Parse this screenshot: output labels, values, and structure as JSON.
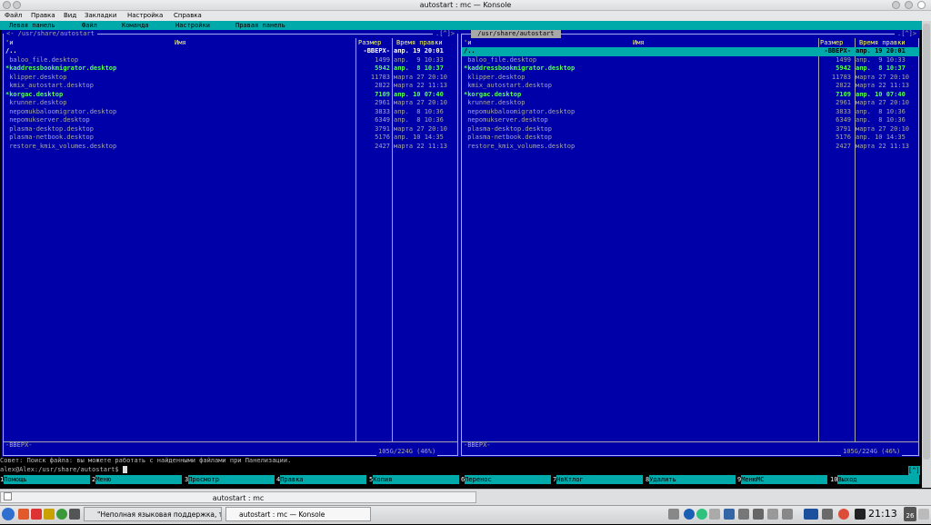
{
  "window": {
    "title": "autostart : mc — Konsole"
  },
  "menu": [
    "Файл",
    "Правка",
    "Вид",
    "Закладки",
    "Настройка",
    "Справка"
  ],
  "mc_menu": [
    "Левая панель",
    "Файл",
    "Команда",
    "Настройки",
    "Правая панель"
  ],
  "left_panel": {
    "path": "<- /usr/share/autostart",
    "corner": ".[^]>",
    "status": "-ВВЕРХ-",
    "disk": "105G/224G (46%)"
  },
  "right_panel": {
    "path": " /usr/share/autostart ",
    "corner": ".[^]>",
    "status": "-ВВЕРХ-",
    "disk": "105G/224G (46%)"
  },
  "columns": {
    "marker": "'и",
    "name": "Имя",
    "size": "Размер",
    "time": "Время правки"
  },
  "files": [
    {
      "name": "/..",
      "size": "-ВВЕРХ-",
      "time": "апр. 19 20:01",
      "kind": "parent"
    },
    {
      "name": " baloo_file.desktop",
      "size": "1499",
      "time": "апр.  9 10:33",
      "kind": "file"
    },
    {
      "name": "*kaddressbookmigrator.desktop",
      "size": "5942",
      "time": "апр.  8 10:37",
      "kind": "exec"
    },
    {
      "name": " klipper.desktop",
      "size": "11783",
      "time": "марта 27 20:10",
      "kind": "file"
    },
    {
      "name": " kmix_autostart.desktop",
      "size": "2822",
      "time": "марта 22 11:13",
      "kind": "file"
    },
    {
      "name": "*korgac.desktop",
      "size": "7109",
      "time": "апр. 10 07:40",
      "kind": "exec"
    },
    {
      "name": " krunner.desktop",
      "size": "2961",
      "time": "марта 27 20:10",
      "kind": "file"
    },
    {
      "name": " nepomukbaloomigrator.desktop",
      "size": "3833",
      "time": "апр.  8 10:36",
      "kind": "file"
    },
    {
      "name": " nepomukserver.desktop",
      "size": "6349",
      "time": "апр.  8 10:36",
      "kind": "file"
    },
    {
      "name": " plasma-desktop.desktop",
      "size": "3791",
      "time": "марта 27 20:10",
      "kind": "file"
    },
    {
      "name": " plasma-netbook.desktop",
      "size": "5176",
      "time": "апр. 10 14:35",
      "kind": "file"
    },
    {
      "name": " restore_kmix_volumes.desktop",
      "size": "2427",
      "time": "марта 22 11:13",
      "kind": "file"
    }
  ],
  "hint": "Совет: Поиск файла: вы можете работать с найденными файлами при Панелизации.",
  "prompt": "alex@Alex:/usr/share/autostart$ ",
  "scroll_marker": "[^]",
  "fkeys": [
    {
      "num": "1",
      "label": "Помощь"
    },
    {
      "num": "2",
      "label": "Меню"
    },
    {
      "num": "3",
      "label": "Просмотр"
    },
    {
      "num": "4",
      "label": "Правка"
    },
    {
      "num": "5",
      "label": "Копия"
    },
    {
      "num": "6",
      "label": "Перенос"
    },
    {
      "num": "7",
      "label": "НвКтлог"
    },
    {
      "num": "8",
      "label": "Удалить"
    },
    {
      "num": "9",
      "label": "МенюМС"
    },
    {
      "num": "10",
      "label": "Выход"
    }
  ],
  "tab": {
    "label": "autostart : mc"
  },
  "taskbar": {
    "tasks": [
      "\"Неполная языковая поддержка, т",
      "autostart : mc — Konsole"
    ],
    "clock": "21:13",
    "date": "26"
  },
  "colors": {
    "panel_bg": "#0000a8",
    "accent_cyan": "#00aaaa",
    "exec_green": "#55ff55",
    "header_yellow": "#ffff55"
  }
}
